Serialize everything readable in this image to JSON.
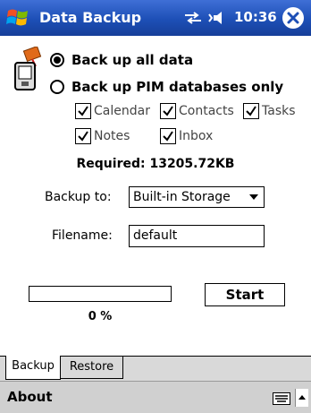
{
  "titlebar": {
    "title": "Data Backup",
    "time": "10:36"
  },
  "options": {
    "all_label": "Back up all data",
    "pim_label": "Back up PIM databases only",
    "selected": "all"
  },
  "databases": [
    {
      "label": "Calendar",
      "checked": true
    },
    {
      "label": "Contacts",
      "checked": true
    },
    {
      "label": "Tasks",
      "checked": true
    },
    {
      "label": "Notes",
      "checked": true
    },
    {
      "label": "Inbox",
      "checked": true
    }
  ],
  "required_text": "Required: 13205.72KB",
  "backup_to": {
    "label": "Backup to:",
    "value": "Built-in Storage"
  },
  "filename": {
    "label": "Filename:",
    "value": "default"
  },
  "progress": {
    "value": 0,
    "text": "0 %"
  },
  "start_button": "Start",
  "tabs": [
    {
      "label": "Backup",
      "active": true
    },
    {
      "label": "Restore",
      "active": false
    }
  ],
  "menu": {
    "about": "About"
  }
}
